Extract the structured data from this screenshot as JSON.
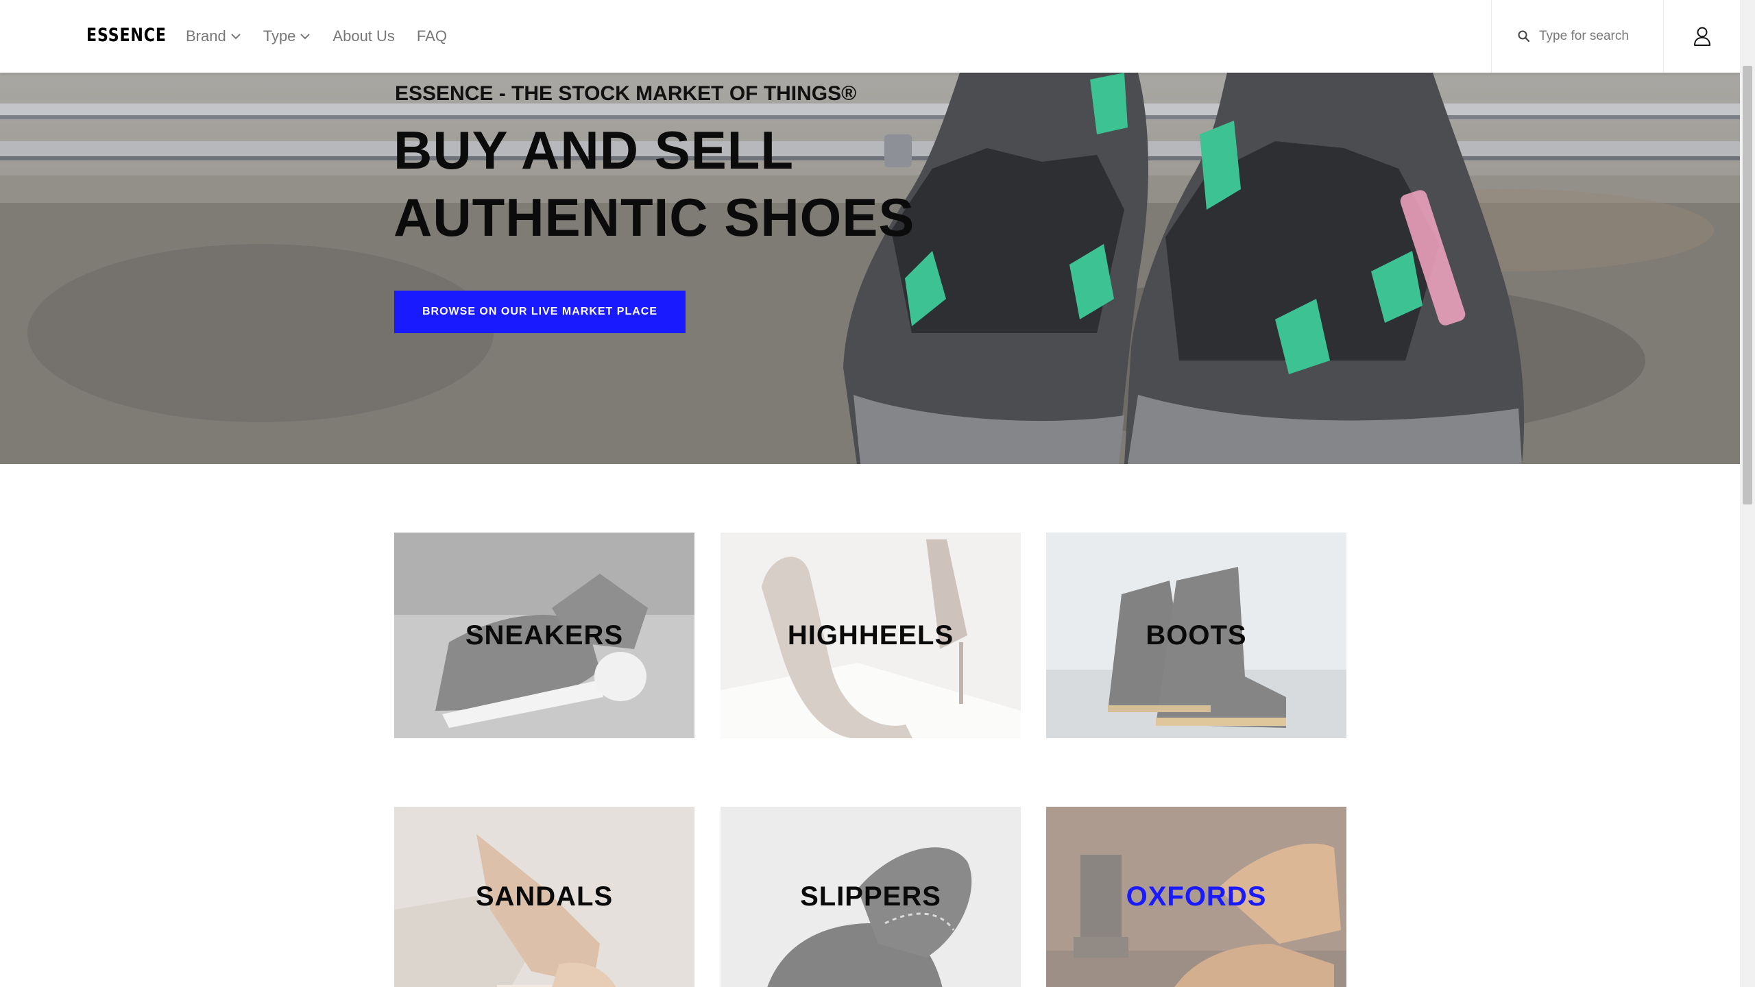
{
  "header": {
    "logo": "ESSENCE",
    "nav": [
      {
        "label": "Brand",
        "dropdown": true
      },
      {
        "label": "Type",
        "dropdown": true
      },
      {
        "label": "About Us",
        "dropdown": false
      },
      {
        "label": "FAQ",
        "dropdown": false
      }
    ],
    "search_placeholder": "Type for search",
    "icons": {
      "search": "search-icon",
      "user": "user-icon",
      "dropdown": "chevron-down-icon"
    }
  },
  "hero": {
    "kicker": "ESSENCE - THE STOCK MARKET OF THINGS®",
    "title_line1": "BUY AND SELL",
    "title_line2": "AUTHENTIC SHOES",
    "cta_label": "BROWSE ON OUR LIVE MARKET PLACE"
  },
  "categories": [
    {
      "label": "SNEAKERS"
    },
    {
      "label": "HIGHHEELS"
    },
    {
      "label": "BOOTS"
    },
    {
      "label": "SANDALS"
    },
    {
      "label": "SLIPPERS"
    },
    {
      "label": "OXFORDS",
      "hovered": true
    }
  ],
  "colors": {
    "accent": "#1a1aff",
    "nav_text": "#787878",
    "heading": "#0b0b0b"
  }
}
